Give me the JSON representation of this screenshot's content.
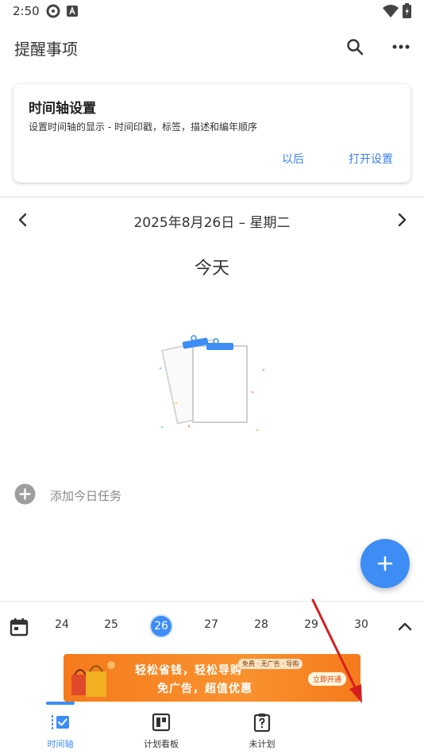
{
  "status_bar": {
    "time": "2:50",
    "icons": [
      "shield-icon",
      "a-badge-icon",
      "wifi-icon",
      "battery-icon"
    ]
  },
  "app_bar": {
    "title": "提醒事项",
    "icons": [
      "search-icon",
      "more-icon"
    ]
  },
  "timeline_card": {
    "title": "时间轴设置",
    "description": "设置时间轴的显示 - 时间印戳，标签，描述和编年顺序",
    "later_label": "以后",
    "open_label": "打开设置"
  },
  "date_nav": {
    "date_label": "2025年8月26日 – 星期二",
    "prev_icon": "chevron-left-icon",
    "next_icon": "chevron-right-icon"
  },
  "today": {
    "label": "今天"
  },
  "add_task": {
    "label": "添加今日任务"
  },
  "week_strip": {
    "days": [
      "24",
      "25",
      "26",
      "27",
      "28",
      "29",
      "30"
    ],
    "selected": "26"
  },
  "ad": {
    "line1": "轻松省钱，轻松导购",
    "line2": "免广告，超值优惠",
    "tags": "免费 · 无广告 · 导购",
    "cta": "立即开通"
  },
  "bottom_nav": {
    "items": [
      {
        "label": "时间轴",
        "active": true
      },
      {
        "label": "计划看板",
        "active": false
      },
      {
        "label": "未计划",
        "active": false
      }
    ]
  },
  "colors": {
    "accent": "#3d8df5",
    "link": "#3b82e8",
    "ad": "#f57a1c",
    "annotation": "#d81f1f"
  }
}
